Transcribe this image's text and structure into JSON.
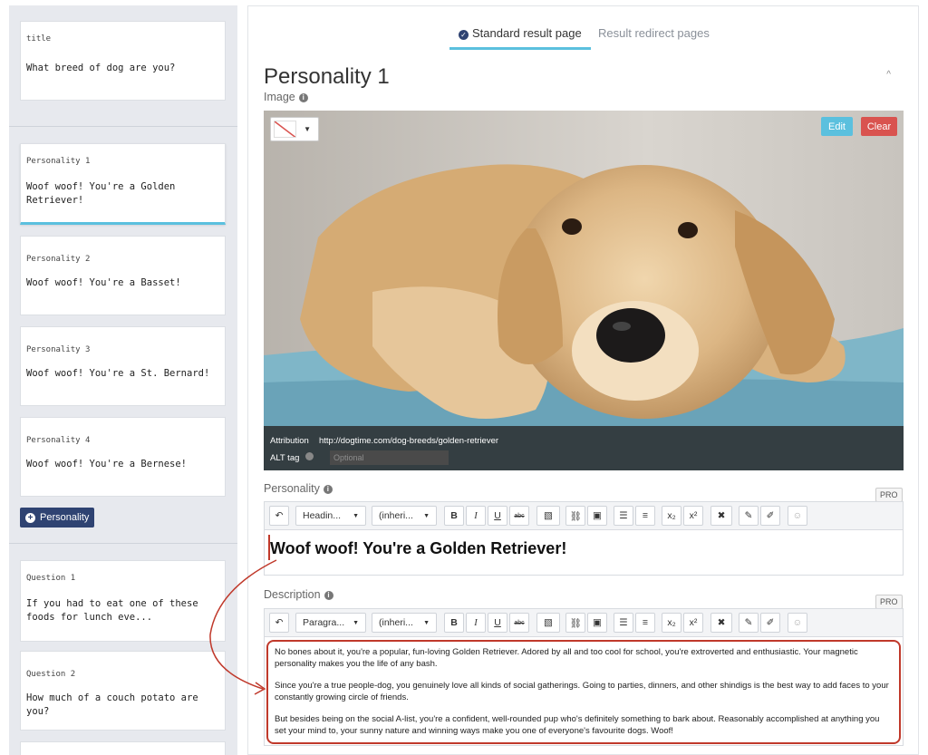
{
  "sidebar": {
    "title_card": {
      "label": "title",
      "text": "What breed of dog are you?"
    },
    "personalities": [
      {
        "label": "Personality 1",
        "text": "Woof woof! You're a Golden Retriever!"
      },
      {
        "label": "Personality 2",
        "text": "Woof woof! You're a Basset!"
      },
      {
        "label": "Personality 3",
        "text": "Woof woof! You're a St. Bernard!"
      },
      {
        "label": "Personality 4",
        "text": "Woof woof! You're a Bernese!"
      }
    ],
    "add_button_label": "Personality",
    "questions": [
      {
        "label": "Question 1",
        "text": "If you had to eat one of these foods for lunch eve..."
      },
      {
        "label": "Question 2",
        "text": "How much of a couch potato are you?"
      }
    ]
  },
  "tabs": {
    "standard": "Standard result page",
    "redirect": "Result redirect pages"
  },
  "main": {
    "title": "Personality 1",
    "image_label": "Image",
    "edit_label": "Edit",
    "clear_label": "Clear",
    "attribution_label": "Attribution",
    "attribution_value": "http://dogtime.com/dog-breeds/golden-retriever",
    "alt_label": "ALT tag",
    "alt_placeholder": "Optional",
    "personality_label": "Personality",
    "pro_badge": "PRO",
    "personality_heading": "Woof woof! You're a Golden Retriever!",
    "description_label": "Description",
    "description": [
      "No bones about it, you're a popular, fun-loving Golden Retriever. Adored by all and too cool for school, you're extroverted and enthusiastic. Your magnetic personality makes you the life of any bash.",
      "Since you're a true people-dog, you genuinely love all kinds of social gatherings. Going to parties, dinners, and other shindigs is the best way to add faces to your constantly growing circle of friends.",
      "But besides being on the social A-list, you're a confident, well-rounded pup who's definitely something to bark about. Reasonably accomplished at anything you set your mind to, your sunny nature and winning ways make you one of everyone's favourite dogs. Woof!"
    ]
  },
  "toolbar_personality": {
    "format": "Headin...",
    "font": "(inheri..."
  },
  "toolbar_description": {
    "format": "Paragra...",
    "font": "(inheri..."
  },
  "toolbar_buttons": {
    "bold": "B",
    "italic": "I",
    "underline": "U",
    "strike": "abc",
    "subscript": "x₂",
    "superscript": "x²",
    "undo": "↶",
    "emoji": "☺"
  },
  "colors": {
    "accent": "#5bc0de",
    "primary": "#2f4372",
    "danger": "#d9534f"
  }
}
